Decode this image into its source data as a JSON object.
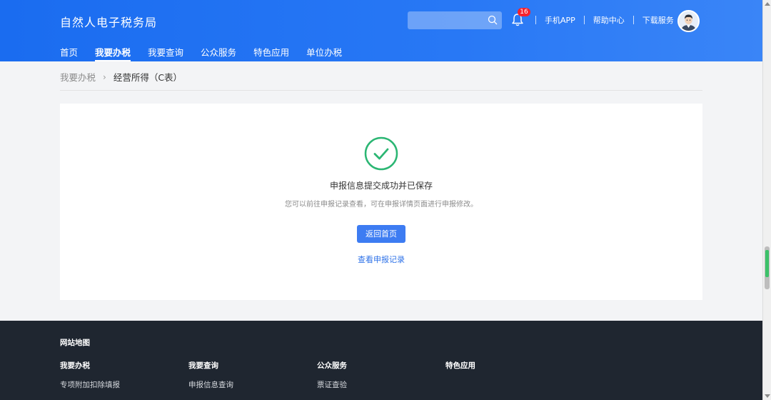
{
  "header": {
    "brand": "自然人电子税务局",
    "notification_count": "16",
    "links": [
      "手机APP",
      "帮助中心",
      "下载服务"
    ],
    "nav": [
      "首页",
      "我要办税",
      "我要查询",
      "公众服务",
      "特色应用",
      "单位办税"
    ],
    "active_nav": 1
  },
  "breadcrumb": {
    "parent": "我要办税",
    "current": "经营所得（C表）"
  },
  "result": {
    "title": "申报信息提交成功并已保存",
    "description": "您可以前往申报记录查看，可在申报详情页面进行申报修改。",
    "primary_button": "返回首页",
    "link": "查看申报记录"
  },
  "footer": {
    "map_title": "网站地图",
    "columns": [
      {
        "heading": "我要办税",
        "item": "专项附加扣除填报"
      },
      {
        "heading": "我要查询",
        "item": "申报信息查询"
      },
      {
        "heading": "公众服务",
        "item": "票证查验"
      },
      {
        "heading": "特色应用",
        "item": ""
      }
    ]
  },
  "colors": {
    "header_blue": "#1a6cf0",
    "success_green": "#2bb673",
    "primary_button": "#3d7cf2",
    "footer_bg": "#1f2630"
  }
}
